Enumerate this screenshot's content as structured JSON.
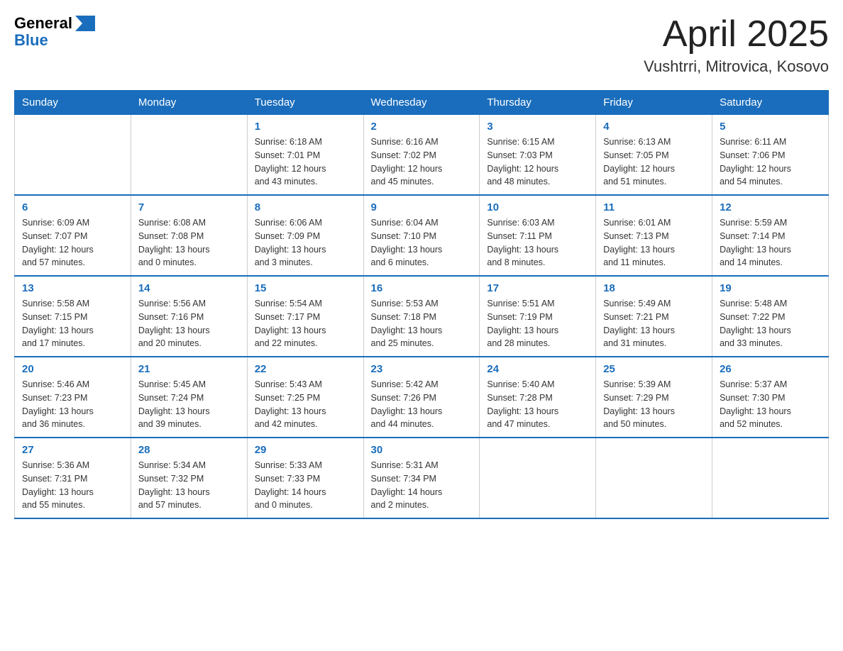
{
  "header": {
    "logo_general": "General",
    "logo_blue": "Blue",
    "month_title": "April 2025",
    "location": "Vushtrri, Mitrovica, Kosovo"
  },
  "weekdays": [
    "Sunday",
    "Monday",
    "Tuesday",
    "Wednesday",
    "Thursday",
    "Friday",
    "Saturday"
  ],
  "weeks": [
    [
      {
        "day": "",
        "info": ""
      },
      {
        "day": "",
        "info": ""
      },
      {
        "day": "1",
        "info": "Sunrise: 6:18 AM\nSunset: 7:01 PM\nDaylight: 12 hours\nand 43 minutes."
      },
      {
        "day": "2",
        "info": "Sunrise: 6:16 AM\nSunset: 7:02 PM\nDaylight: 12 hours\nand 45 minutes."
      },
      {
        "day": "3",
        "info": "Sunrise: 6:15 AM\nSunset: 7:03 PM\nDaylight: 12 hours\nand 48 minutes."
      },
      {
        "day": "4",
        "info": "Sunrise: 6:13 AM\nSunset: 7:05 PM\nDaylight: 12 hours\nand 51 minutes."
      },
      {
        "day": "5",
        "info": "Sunrise: 6:11 AM\nSunset: 7:06 PM\nDaylight: 12 hours\nand 54 minutes."
      }
    ],
    [
      {
        "day": "6",
        "info": "Sunrise: 6:09 AM\nSunset: 7:07 PM\nDaylight: 12 hours\nand 57 minutes."
      },
      {
        "day": "7",
        "info": "Sunrise: 6:08 AM\nSunset: 7:08 PM\nDaylight: 13 hours\nand 0 minutes."
      },
      {
        "day": "8",
        "info": "Sunrise: 6:06 AM\nSunset: 7:09 PM\nDaylight: 13 hours\nand 3 minutes."
      },
      {
        "day": "9",
        "info": "Sunrise: 6:04 AM\nSunset: 7:10 PM\nDaylight: 13 hours\nand 6 minutes."
      },
      {
        "day": "10",
        "info": "Sunrise: 6:03 AM\nSunset: 7:11 PM\nDaylight: 13 hours\nand 8 minutes."
      },
      {
        "day": "11",
        "info": "Sunrise: 6:01 AM\nSunset: 7:13 PM\nDaylight: 13 hours\nand 11 minutes."
      },
      {
        "day": "12",
        "info": "Sunrise: 5:59 AM\nSunset: 7:14 PM\nDaylight: 13 hours\nand 14 minutes."
      }
    ],
    [
      {
        "day": "13",
        "info": "Sunrise: 5:58 AM\nSunset: 7:15 PM\nDaylight: 13 hours\nand 17 minutes."
      },
      {
        "day": "14",
        "info": "Sunrise: 5:56 AM\nSunset: 7:16 PM\nDaylight: 13 hours\nand 20 minutes."
      },
      {
        "day": "15",
        "info": "Sunrise: 5:54 AM\nSunset: 7:17 PM\nDaylight: 13 hours\nand 22 minutes."
      },
      {
        "day": "16",
        "info": "Sunrise: 5:53 AM\nSunset: 7:18 PM\nDaylight: 13 hours\nand 25 minutes."
      },
      {
        "day": "17",
        "info": "Sunrise: 5:51 AM\nSunset: 7:19 PM\nDaylight: 13 hours\nand 28 minutes."
      },
      {
        "day": "18",
        "info": "Sunrise: 5:49 AM\nSunset: 7:21 PM\nDaylight: 13 hours\nand 31 minutes."
      },
      {
        "day": "19",
        "info": "Sunrise: 5:48 AM\nSunset: 7:22 PM\nDaylight: 13 hours\nand 33 minutes."
      }
    ],
    [
      {
        "day": "20",
        "info": "Sunrise: 5:46 AM\nSunset: 7:23 PM\nDaylight: 13 hours\nand 36 minutes."
      },
      {
        "day": "21",
        "info": "Sunrise: 5:45 AM\nSunset: 7:24 PM\nDaylight: 13 hours\nand 39 minutes."
      },
      {
        "day": "22",
        "info": "Sunrise: 5:43 AM\nSunset: 7:25 PM\nDaylight: 13 hours\nand 42 minutes."
      },
      {
        "day": "23",
        "info": "Sunrise: 5:42 AM\nSunset: 7:26 PM\nDaylight: 13 hours\nand 44 minutes."
      },
      {
        "day": "24",
        "info": "Sunrise: 5:40 AM\nSunset: 7:28 PM\nDaylight: 13 hours\nand 47 minutes."
      },
      {
        "day": "25",
        "info": "Sunrise: 5:39 AM\nSunset: 7:29 PM\nDaylight: 13 hours\nand 50 minutes."
      },
      {
        "day": "26",
        "info": "Sunrise: 5:37 AM\nSunset: 7:30 PM\nDaylight: 13 hours\nand 52 minutes."
      }
    ],
    [
      {
        "day": "27",
        "info": "Sunrise: 5:36 AM\nSunset: 7:31 PM\nDaylight: 13 hours\nand 55 minutes."
      },
      {
        "day": "28",
        "info": "Sunrise: 5:34 AM\nSunset: 7:32 PM\nDaylight: 13 hours\nand 57 minutes."
      },
      {
        "day": "29",
        "info": "Sunrise: 5:33 AM\nSunset: 7:33 PM\nDaylight: 14 hours\nand 0 minutes."
      },
      {
        "day": "30",
        "info": "Sunrise: 5:31 AM\nSunset: 7:34 PM\nDaylight: 14 hours\nand 2 minutes."
      },
      {
        "day": "",
        "info": ""
      },
      {
        "day": "",
        "info": ""
      },
      {
        "day": "",
        "info": ""
      }
    ]
  ]
}
